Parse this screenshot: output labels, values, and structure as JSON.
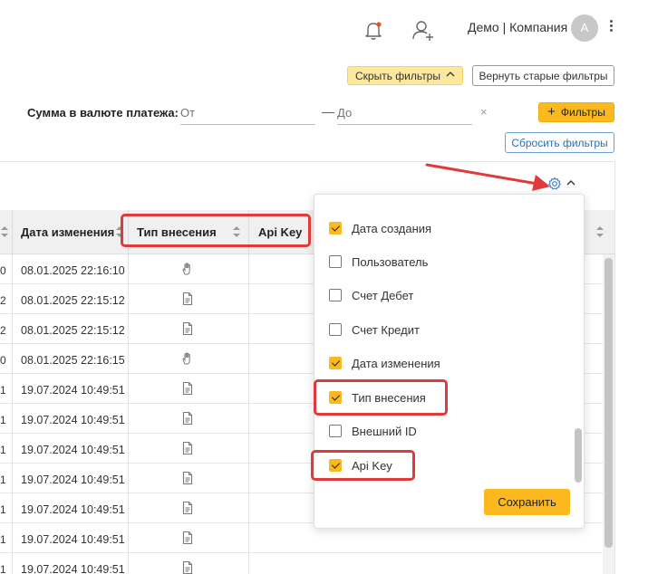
{
  "header": {
    "company": "Демо | Компания",
    "avatar_letter": "А",
    "icons": {
      "bell": "bell-icon",
      "add_user": "add-user-icon",
      "more": "more-vertical-icon"
    },
    "notification_dot_color": "#e5532b"
  },
  "filters": {
    "hide_label": "Скрыть фильтры",
    "old_label": "Вернуть старые фильтры",
    "amount_label": "Сумма в валюте платежа:",
    "from_placeholder": "От",
    "to_placeholder": "До",
    "dash": "—",
    "clear": "×",
    "filters_label": "Фильтры",
    "plus": "+",
    "reset_label": "Сбросить фильтры"
  },
  "table": {
    "headers": {
      "date_changed": "Дата изменения",
      "input_type": "Тип внесения",
      "api_key": "Api Key"
    },
    "rows": [
      {
        "c0": "0",
        "date": "08.01.2025 22:16:10",
        "type": "hand"
      },
      {
        "c0": "2",
        "date": "08.01.2025 22:15:12",
        "type": "doc"
      },
      {
        "c0": "2",
        "date": "08.01.2025 22:15:12",
        "type": "doc"
      },
      {
        "c0": "0",
        "date": "08.01.2025 22:16:15",
        "type": "hand"
      },
      {
        "c0": "1",
        "date": "19.07.2024 10:49:51",
        "type": "doc"
      },
      {
        "c0": "1",
        "date": "19.07.2024 10:49:51",
        "type": "doc"
      },
      {
        "c0": "1",
        "date": "19.07.2024 10:49:51",
        "type": "doc"
      },
      {
        "c0": "1",
        "date": "19.07.2024 10:49:51",
        "type": "doc"
      },
      {
        "c0": "1",
        "date": "19.07.2024 10:49:51",
        "type": "doc"
      },
      {
        "c0": "1",
        "date": "19.07.2024 10:49:51",
        "type": "doc"
      },
      {
        "c0": "1",
        "date": "19.07.2024 10:49:51",
        "type": "doc"
      }
    ]
  },
  "columns_panel": {
    "options": [
      {
        "label": "Дата создания",
        "checked": true
      },
      {
        "label": "Пользователь",
        "checked": false
      },
      {
        "label": "Счет Дебет",
        "checked": false
      },
      {
        "label": "Счет Кредит",
        "checked": false
      },
      {
        "label": "Дата изменения",
        "checked": true
      },
      {
        "label": "Тип внесения",
        "checked": true
      },
      {
        "label": "Внешний ID",
        "checked": false
      },
      {
        "label": "Api Key",
        "checked": true
      }
    ],
    "save_label": "Сохранить"
  },
  "colors": {
    "accent": "#fbb91d",
    "annotation": "#e03a3a",
    "link": "#2d6fb5"
  }
}
